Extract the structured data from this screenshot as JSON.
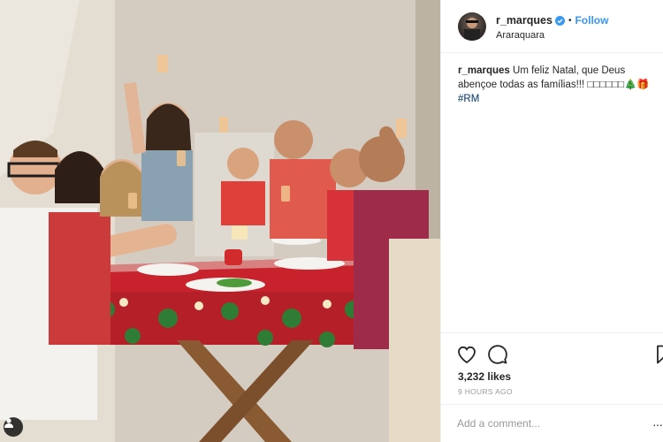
{
  "post": {
    "username": "r_marques",
    "follow_label": "Follow",
    "dot": "•",
    "location": "Araraquara",
    "caption_user": "r_marques",
    "caption_text": "Um feliz Natal, que Deus abençoe todas as famílias!!! □□□□□□🎄🎁",
    "hashtag": "#RM",
    "likes": "3,232 likes",
    "timestamp": "9 HOURS AGO",
    "comment_placeholder": "Add a comment..."
  },
  "icons": {
    "verified": "verified-badge-icon",
    "like": "heart-icon",
    "comment": "speech-bubble-icon",
    "save": "bookmark-icon",
    "profile": "person-icon"
  },
  "colors": {
    "link": "#3897f0",
    "verified": "#3897f0",
    "hashtag": "#003569",
    "tablecloth": "#c8232c"
  }
}
